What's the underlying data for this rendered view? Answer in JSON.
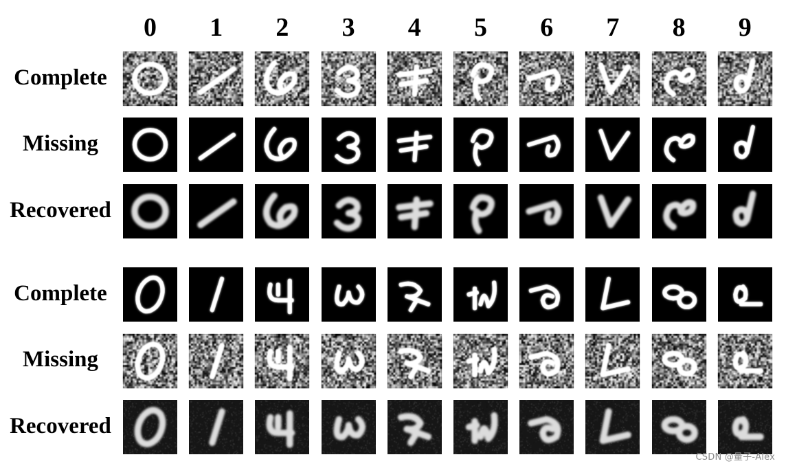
{
  "figure": {
    "column_headers": [
      "0",
      "1",
      "2",
      "3",
      "4",
      "5",
      "6",
      "7",
      "8",
      "9"
    ],
    "blocks": [
      {
        "rows": [
          {
            "label": "Complete",
            "style": "noisy"
          },
          {
            "label": "Missing",
            "style": "clean"
          },
          {
            "label": "Recovered",
            "style": "blurred"
          }
        ],
        "digit_shapes": [
          "0-ring",
          "1-diag-up",
          "6-loop",
          "3-open",
          "7-cross",
          "2-hook",
          "9-curl",
          "7-vee",
          "8-loop",
          "9-d"
        ]
      },
      {
        "rows": [
          {
            "label": "Complete",
            "style": "clean"
          },
          {
            "label": "Missing",
            "style": "noisy"
          },
          {
            "label": "Recovered",
            "style": "blurred-gray"
          }
        ],
        "digit_shapes": [
          "0-upright",
          "1-upright",
          "4-open",
          "3-omega",
          "2-z",
          "2-n",
          "6-round",
          "4-L",
          "8-flat",
          "6-a"
        ]
      }
    ]
  },
  "watermark": "CSDN @量子-Alex"
}
